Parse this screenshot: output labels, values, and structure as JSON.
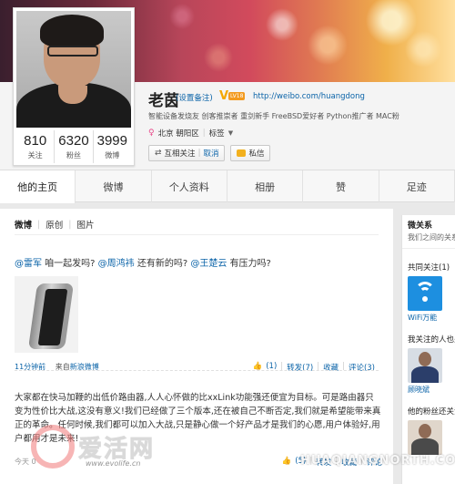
{
  "profile": {
    "name": "老茵",
    "remark_link": "(设置备注)",
    "verified_badge": "V",
    "level_badge": "LV18",
    "weibo_url": "http://weibo.com/huangdong",
    "tagline": "智能设备发烧友 创客推崇者 重剑新手 FreeBSD爱好者 Python推广者 MAC粉",
    "location": "北京 朝阳区",
    "tags_label": "标签",
    "stats": [
      {
        "value": "810",
        "label": "关注"
      },
      {
        "value": "6320",
        "label": "粉丝"
      },
      {
        "value": "3999",
        "label": "微博"
      }
    ],
    "actions": {
      "mutual_follow": "互相关注",
      "cancel": "取消",
      "message": "私信"
    }
  },
  "tabs": [
    "他的主页",
    "微博",
    "个人资料",
    "相册",
    "赞",
    "足迹"
  ],
  "feed": {
    "filters": [
      "微博",
      "原创",
      "图片"
    ],
    "post1": {
      "mention1": "@雷军",
      "text1": " 咱一起发吗? ",
      "mention2": "@周鸿祎",
      "text2": " 还有新的吗? ",
      "mention3": "@王楚云",
      "text3": " 有压力吗?",
      "time": "11分钟前",
      "source_prefix": "来自",
      "source": "新浪微博",
      "likes": "(1)",
      "repost": "转发(7)",
      "favorite": "收藏",
      "comments": "评论(3)"
    },
    "post2": {
      "text": "大家都在快马加鞭的出低价路由器,人人心怀做的比xxLink功能强还便宜为目标。可是路由器只变为性价比大战,这没有意义!我们已经做了三个版本,还在被自己不断否定,我们就是希望能带来真正的革命。任何时候,我们都可以加入大战,只是静心做一个好产品才是我们的心愿,用户体验好,用户都用才是未来!",
      "time": "今天 0",
      "likes": "(5)",
      "repost": "转发",
      "favorite": "收藏",
      "comments": "评论"
    }
  },
  "sidebar": {
    "title": "微关系",
    "subtitle": "我们之间的关系",
    "common_follow": "共同关注(1)",
    "common_name": "WiFi万能",
    "also_follow": "我关注的人也关",
    "also_name": "顾晓斌",
    "fans_follow": "他的粉丝还关注"
  },
  "watermarks": {
    "logo_text": "爱活网",
    "logo_url": "www.evolife.cn",
    "right_text": "HUAQIANGNORTH.COM"
  },
  "colors": {
    "link": "#0a63a8",
    "verified": "#f4a700",
    "level": "#f39a1e",
    "female": "#e8488a"
  }
}
